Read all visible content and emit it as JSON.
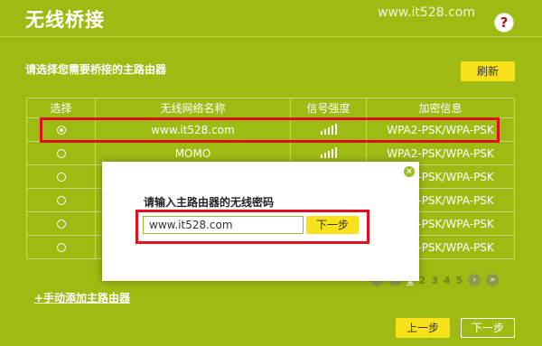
{
  "page": {
    "title": "无线桥接",
    "watermark": "www.it528.com",
    "help_glyph": "?",
    "subtitle": "请选择您需要桥接的主路由器",
    "refresh_label": "刷新"
  },
  "table": {
    "headers": [
      "选择",
      "无线网络名称",
      "信号强度",
      "加密信息"
    ],
    "rows": [
      {
        "selected": true,
        "ssid": "www.it528.com",
        "signal_level": 5,
        "encryption": "WPA2-PSK/WPA-PSK"
      },
      {
        "selected": false,
        "ssid": "MOMO",
        "signal_level": 5,
        "encryption": "WPA2-PSK/WPA-PSK"
      },
      {
        "selected": false,
        "ssid": "",
        "signal_level": 0,
        "encryption": "WPA2-PSK/WPA-PSK"
      },
      {
        "selected": false,
        "ssid": "",
        "signal_level": 0,
        "encryption": "WPA2-PSK/WPA-PSK"
      },
      {
        "selected": false,
        "ssid": "",
        "signal_level": 0,
        "encryption": "WPA2-PSK/WPA-PSK"
      },
      {
        "selected": false,
        "ssid": "",
        "signal_level": 0,
        "encryption": "WPA2-PSK/WPA-PSK"
      }
    ]
  },
  "pagination": {
    "pages": [
      "1",
      "2",
      "3",
      "4",
      "5"
    ],
    "current": "1",
    "first_glyph": "«",
    "prev_glyph": "‹",
    "next_glyph": "›",
    "last_glyph": "»"
  },
  "manual_add_label": "+手动添加主路由器",
  "footer": {
    "prev_label": "上一步",
    "next_label": "下一步"
  },
  "dialog": {
    "prompt": "请输入主路由器的无线密码",
    "password_value": "www.it528.com",
    "next_label": "下一步",
    "close_glyph": "×"
  },
  "colors": {
    "background": "#9dbb13",
    "button": "#f7e11b",
    "highlight": "#e0101f"
  },
  "icons": {
    "help": "help-icon",
    "close": "close-icon",
    "signal": "signal-bars-icon"
  }
}
